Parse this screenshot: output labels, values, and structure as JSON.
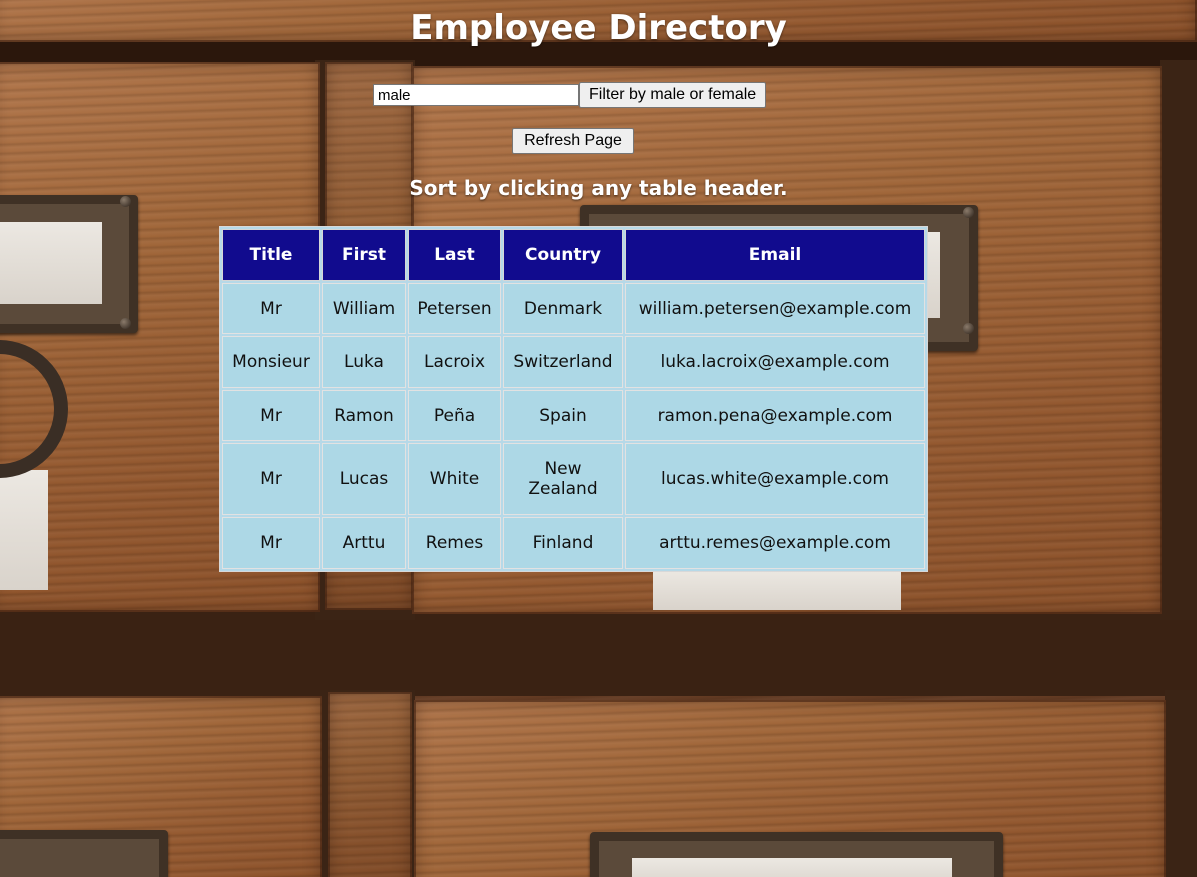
{
  "page": {
    "title": "Employee Directory",
    "hint": "Sort by clicking any table header."
  },
  "filter": {
    "value": "male",
    "button_label": "Filter by male or female"
  },
  "refresh": {
    "label": "Refresh Page"
  },
  "table": {
    "headers": {
      "title": "Title",
      "first": "First",
      "last": "Last",
      "country": "Country",
      "email": "Email"
    },
    "rows": [
      {
        "title": "Mr",
        "first": "William",
        "last": "Petersen",
        "country": "Denmark",
        "email": "william.petersen@example.com"
      },
      {
        "title": "Monsieur",
        "first": "Luka",
        "last": "Lacroix",
        "country": "Switzerland",
        "email": "luka.lacroix@example.com"
      },
      {
        "title": "Mr",
        "first": "Ramon",
        "last": "Peña",
        "country": "Spain",
        "email": "ramon.pena@example.com"
      },
      {
        "title": "Mr",
        "first": "Lucas",
        "last": "White",
        "country": "New Zealand",
        "email": "lucas.white@example.com"
      },
      {
        "title": "Mr",
        "first": "Arttu",
        "last": "Remes",
        "country": "Finland",
        "email": "arttu.remes@example.com"
      }
    ]
  },
  "colors": {
    "header_bg": "#110b8e",
    "cell_bg": "#add8e6",
    "title_text": "#ffffff"
  }
}
